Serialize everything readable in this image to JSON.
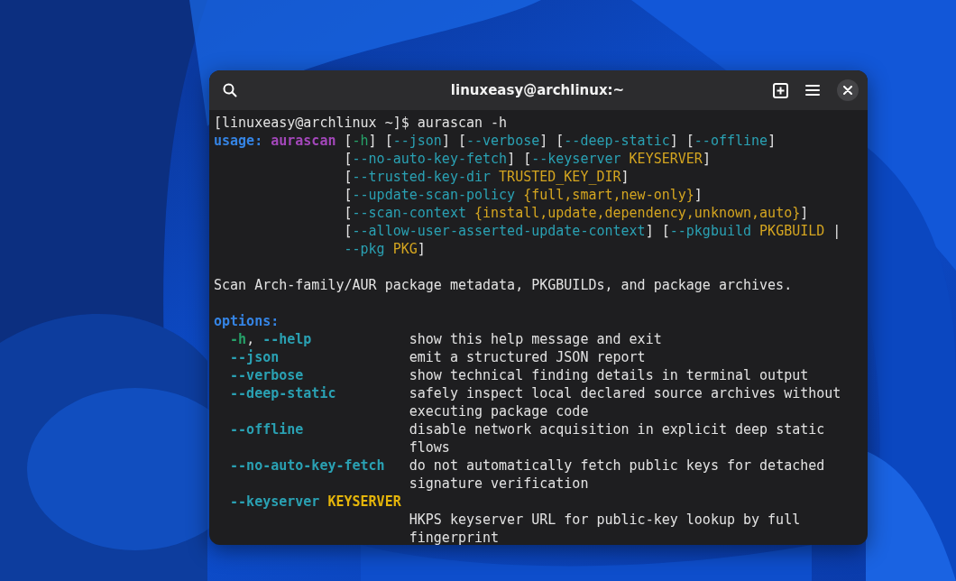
{
  "window": {
    "title": "linuxeasy@archlinux:~"
  },
  "terminal": {
    "lines": [
      {
        "segments": [
          {
            "kind": "text",
            "text": "[linuxeasy@archlinux ~]$ aurascan -h"
          }
        ]
      },
      {
        "segments": [
          {
            "kind": "heading",
            "text": "usage:"
          },
          {
            "kind": "prog",
            "text": " aurascan"
          },
          {
            "kind": "text",
            "text": " ["
          },
          {
            "kind": "short",
            "text": "-h"
          },
          {
            "kind": "text",
            "text": "] ["
          },
          {
            "kind": "flag",
            "text": "--json"
          },
          {
            "kind": "text",
            "text": "] ["
          },
          {
            "kind": "flag",
            "text": "--verbose"
          },
          {
            "kind": "text",
            "text": "] ["
          },
          {
            "kind": "flag",
            "text": "--deep-static"
          },
          {
            "kind": "text",
            "text": "] ["
          },
          {
            "kind": "flag",
            "text": "--offline"
          },
          {
            "kind": "text",
            "text": "]"
          }
        ]
      },
      {
        "segments": [
          {
            "kind": "text",
            "text": "                ["
          },
          {
            "kind": "flag",
            "text": "--no-auto-key-fetch"
          },
          {
            "kind": "text",
            "text": "] ["
          },
          {
            "kind": "flag",
            "text": "--keyserver"
          },
          {
            "kind": "metavar",
            "text": " KEYSERVER"
          },
          {
            "kind": "text",
            "text": "]"
          }
        ]
      },
      {
        "segments": [
          {
            "kind": "text",
            "text": "                ["
          },
          {
            "kind": "flag",
            "text": "--trusted-key-dir"
          },
          {
            "kind": "metavar",
            "text": " TRUSTED_KEY_DIR"
          },
          {
            "kind": "text",
            "text": "]"
          }
        ]
      },
      {
        "segments": [
          {
            "kind": "text",
            "text": "                ["
          },
          {
            "kind": "flag",
            "text": "--update-scan-policy"
          },
          {
            "kind": "metavar",
            "text": " {full,smart,new-only}"
          },
          {
            "kind": "text",
            "text": "]"
          }
        ]
      },
      {
        "segments": [
          {
            "kind": "text",
            "text": "                ["
          },
          {
            "kind": "flag",
            "text": "--scan-context"
          },
          {
            "kind": "metavar",
            "text": " {install,update,dependency,unknown,auto}"
          },
          {
            "kind": "text",
            "text": "]"
          }
        ]
      },
      {
        "segments": [
          {
            "kind": "text",
            "text": "                ["
          },
          {
            "kind": "flag",
            "text": "--allow-user-asserted-update-context"
          },
          {
            "kind": "text",
            "text": "] ["
          },
          {
            "kind": "flag",
            "text": "--pkgbuild"
          },
          {
            "kind": "metavar",
            "text": " PKGBUILD"
          },
          {
            "kind": "text",
            "text": " |"
          }
        ]
      },
      {
        "segments": [
          {
            "kind": "flag",
            "text": "                --pkg"
          },
          {
            "kind": "metavar",
            "text": " PKG"
          },
          {
            "kind": "text",
            "text": "]"
          }
        ]
      },
      {
        "kind": "blank"
      },
      {
        "segments": [
          {
            "kind": "text",
            "text": "Scan Arch-family/AUR package metadata, PKGBUILDs, and package archives."
          }
        ]
      },
      {
        "kind": "blank"
      },
      {
        "segments": [
          {
            "kind": "heading",
            "text": "options:"
          }
        ]
      },
      {
        "segments": [
          {
            "kind": "short-bold",
            "text": "  -h"
          },
          {
            "kind": "text",
            "text": ", "
          },
          {
            "kind": "option",
            "text": "--help"
          },
          {
            "kind": "text",
            "text": "            show this help message and exit"
          }
        ]
      },
      {
        "segments": [
          {
            "kind": "option",
            "text": "  --json"
          },
          {
            "kind": "text",
            "text": "                emit a structured JSON report"
          }
        ]
      },
      {
        "segments": [
          {
            "kind": "option",
            "text": "  --verbose"
          },
          {
            "kind": "text",
            "text": "             show technical finding details in terminal output"
          }
        ]
      },
      {
        "segments": [
          {
            "kind": "option",
            "text": "  --deep-static"
          },
          {
            "kind": "text",
            "text": "         safely inspect local declared source archives without"
          }
        ]
      },
      {
        "segments": [
          {
            "kind": "text",
            "text": "                        executing package code"
          }
        ]
      },
      {
        "segments": [
          {
            "kind": "option",
            "text": "  --offline"
          },
          {
            "kind": "text",
            "text": "             disable network acquisition in explicit deep static"
          }
        ]
      },
      {
        "segments": [
          {
            "kind": "text",
            "text": "                        flows"
          }
        ]
      },
      {
        "segments": [
          {
            "kind": "option",
            "text": "  --no-auto-key-fetch"
          },
          {
            "kind": "text",
            "text": "   do not automatically fetch public keys for detached"
          }
        ]
      },
      {
        "segments": [
          {
            "kind": "text",
            "text": "                        signature verification"
          }
        ]
      },
      {
        "segments": [
          {
            "kind": "option",
            "text": "  --keyserver"
          },
          {
            "kind": "metavar-bold",
            "text": " KEYSERVER"
          }
        ]
      },
      {
        "segments": [
          {
            "kind": "text",
            "text": "                        HKPS keyserver URL for public-key lookup by full"
          }
        ]
      },
      {
        "segments": [
          {
            "kind": "text",
            "text": "                        fingerprint"
          }
        ]
      }
    ]
  }
}
